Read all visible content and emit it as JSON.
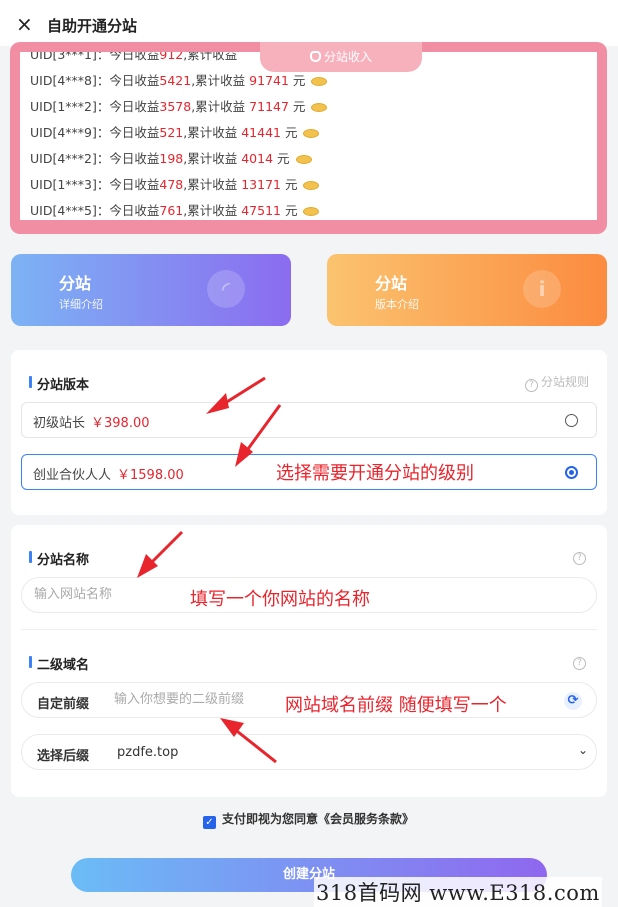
{
  "header": {
    "close_icon": "×",
    "title": "自助开通分站"
  },
  "income": {
    "tab_label": "分站收入",
    "rows": [
      {
        "uid": "UID[3***1]：",
        "today_label": "今日收益",
        "today": "912",
        "total_label": ",累计收益",
        "total": "",
        "unit": ""
      },
      {
        "uid": "UID[4***8]：",
        "today_label": "今日收益",
        "today": "5421",
        "total_label": ",累计收益",
        "total": "91741",
        "unit": "元"
      },
      {
        "uid": "UID[1***2]：",
        "today_label": "今日收益",
        "today": "3578",
        "total_label": ",累计收益",
        "total": "71147",
        "unit": "元"
      },
      {
        "uid": "UID[4***9]：",
        "today_label": "今日收益",
        "today": "521",
        "total_label": ",累计收益",
        "total": "41441",
        "unit": "元"
      },
      {
        "uid": "UID[4***2]：",
        "today_label": "今日收益",
        "today": "198",
        "total_label": ",累计收益",
        "total": "4014",
        "unit": "元"
      },
      {
        "uid": "UID[1***3]：",
        "today_label": "今日收益",
        "today": "478",
        "total_label": ",累计收益",
        "total": "13171",
        "unit": "元"
      },
      {
        "uid": "UID[4***5]：",
        "today_label": "今日收益",
        "today": "761",
        "total_label": ",累计收益",
        "total": "47511",
        "unit": "元"
      }
    ]
  },
  "cards": {
    "left": {
      "title": "分站",
      "subtitle": "详细介绍"
    },
    "right": {
      "title": "分站",
      "subtitle": "版本介绍"
    }
  },
  "version": {
    "heading": "分站版本",
    "rules_link": "分站规则",
    "options": [
      {
        "name": "初级站长",
        "price": "￥398.00",
        "selected": false
      },
      {
        "name": "创业合伙人人",
        "price": "￥1598.00",
        "selected": true
      }
    ]
  },
  "site_name": {
    "heading": "分站名称",
    "placeholder": "输入网站名称"
  },
  "domain": {
    "heading": "二级域名",
    "prefix_label": "自定前缀",
    "prefix_placeholder": "输入你想要的二级前缀",
    "suffix_label": "选择后缀",
    "suffix_value": "pzdfe.top"
  },
  "agreement": {
    "text": "支付即视为您同意《会员服务条款》"
  },
  "submit": {
    "label": "创建分站"
  },
  "annotations": {
    "a1": "选择需要开通分站的级别",
    "a2": "填写一个你网站的名称",
    "a3": "网站域名前缀 随便填写一个",
    "color": "#e8242c"
  },
  "watermark": "318首码网 www.E318.com"
}
